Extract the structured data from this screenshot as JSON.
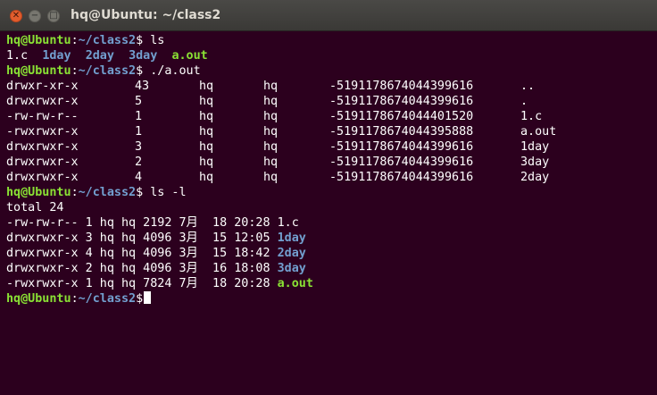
{
  "window": {
    "title": "hq@Ubuntu: ~/class2"
  },
  "icons": {
    "close": "close-icon",
    "minimize": "minimize-icon",
    "maximize": "maximize-icon"
  },
  "colors": {
    "background": "#2c001e",
    "prompt_user": "#8ae234",
    "prompt_path": "#729fcf",
    "text": "#ffffff",
    "directory": "#729fcf",
    "executable": "#8ae234"
  },
  "prompt": {
    "user": "hq@Ubuntu",
    "sep": ":",
    "path": "~/class2",
    "symbol": "$"
  },
  "commands": {
    "ls": " ls",
    "aout": " ./a.out",
    "lsl": " ls -l"
  },
  "ls_output": [
    "1.c",
    "1day",
    "2day",
    "3day",
    "a.out"
  ],
  "aout_rows": [
    {
      "perm": "drwxr-xr-x",
      "links": "43",
      "owner": "hq",
      "group": "hq",
      "size": "-5191178674044399616",
      "name": ".."
    },
    {
      "perm": "drwxrwxr-x",
      "links": "5",
      "owner": "hq",
      "group": "hq",
      "size": "-5191178674044399616",
      "name": "."
    },
    {
      "perm": "-rw-rw-r--",
      "links": "1",
      "owner": "hq",
      "group": "hq",
      "size": "-5191178674044401520",
      "name": "1.c"
    },
    {
      "perm": "-rwxrwxr-x",
      "links": "1",
      "owner": "hq",
      "group": "hq",
      "size": "-5191178674044395888",
      "name": "a.out"
    },
    {
      "perm": "drwxrwxr-x",
      "links": "3",
      "owner": "hq",
      "group": "hq",
      "size": "-5191178674044399616",
      "name": "1day"
    },
    {
      "perm": "drwxrwxr-x",
      "links": "2",
      "owner": "hq",
      "group": "hq",
      "size": "-5191178674044399616",
      "name": "3day"
    },
    {
      "perm": "drwxrwxr-x",
      "links": "4",
      "owner": "hq",
      "group": "hq",
      "size": "-5191178674044399616",
      "name": "2day"
    }
  ],
  "lsl": {
    "total": "total 24",
    "rows": [
      {
        "info": "-rw-rw-r-- 1 hq hq 2192 7月  18 20:28 ",
        "name": "1.c"
      },
      {
        "info": "drwxrwxr-x 3 hq hq 4096 3月  15 12:05 ",
        "name": "1day"
      },
      {
        "info": "drwxrwxr-x 4 hq hq 4096 3月  15 18:42 ",
        "name": "2day"
      },
      {
        "info": "drwxrwxr-x 2 hq hq 4096 3月  16 18:08 ",
        "name": "3day"
      },
      {
        "info": "-rwxrwxr-x 1 hq hq 7824 7月  18 20:28 ",
        "name": "a.out"
      }
    ]
  }
}
